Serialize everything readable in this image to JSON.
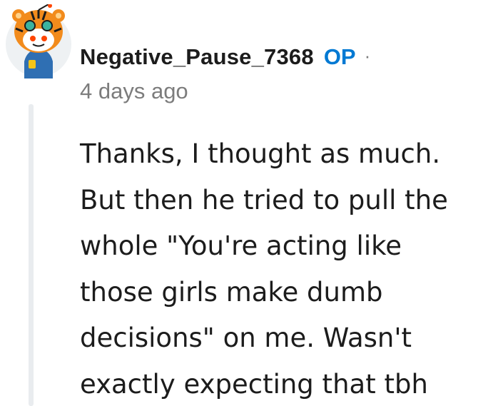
{
  "comment": {
    "username": "Negative_Pause_7368",
    "op_badge": "OP",
    "separator": "·",
    "timestamp": "4 days ago",
    "body_lines": [
      "Thanks, I thought as much.",
      "But then he tried to pull the",
      "whole \"You're acting like",
      "those girls make dumb",
      "decisions\" on me. Wasn't",
      "exactly expecting that tbh"
    ],
    "avatar_icon": "snoo-tiger-avatar-icon"
  },
  "colors": {
    "op_badge": "#0079d3",
    "username": "#1c1c1c",
    "muted": "#7c7c7c",
    "thread_line": "#e9ecef",
    "avatar_bg": "#eef1f3"
  }
}
